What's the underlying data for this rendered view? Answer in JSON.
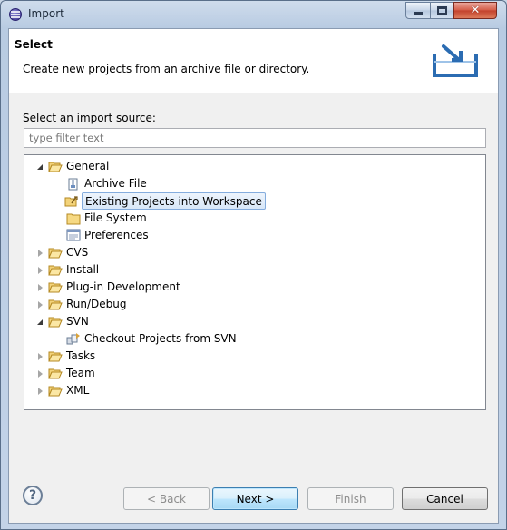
{
  "window": {
    "title": "Import",
    "close_glyph": "✕"
  },
  "banner": {
    "title": "Select",
    "description": "Create new projects from an archive file or directory."
  },
  "source_label": "Select an import source:",
  "filter": {
    "placeholder": "type filter text",
    "value": ""
  },
  "tree": {
    "items": [
      {
        "label": "General",
        "icon": "folder-open-icon",
        "state": "expanded"
      },
      {
        "label": "Archive File",
        "icon": "archive-file-icon"
      },
      {
        "label": "Existing Projects into Workspace",
        "icon": "existing-projects-icon",
        "selected": true
      },
      {
        "label": "File System",
        "icon": "folder-icon"
      },
      {
        "label": "Preferences",
        "icon": "preferences-icon"
      },
      {
        "label": "CVS",
        "icon": "folder-icon",
        "state": "collapsed"
      },
      {
        "label": "Install",
        "icon": "folder-icon",
        "state": "collapsed"
      },
      {
        "label": "Plug-in Development",
        "icon": "folder-icon",
        "state": "collapsed"
      },
      {
        "label": "Run/Debug",
        "icon": "folder-icon",
        "state": "collapsed"
      },
      {
        "label": "SVN",
        "icon": "folder-open-icon",
        "state": "expanded"
      },
      {
        "label": "Checkout Projects from SVN",
        "icon": "svn-checkout-icon"
      },
      {
        "label": "Tasks",
        "icon": "folder-icon",
        "state": "collapsed"
      },
      {
        "label": "Team",
        "icon": "folder-icon",
        "state": "collapsed"
      },
      {
        "label": "XML",
        "icon": "folder-icon",
        "state": "collapsed"
      }
    ]
  },
  "buttons": {
    "help": "?",
    "back": "< Back",
    "next": "Next >",
    "finish": "Finish",
    "cancel": "Cancel"
  }
}
